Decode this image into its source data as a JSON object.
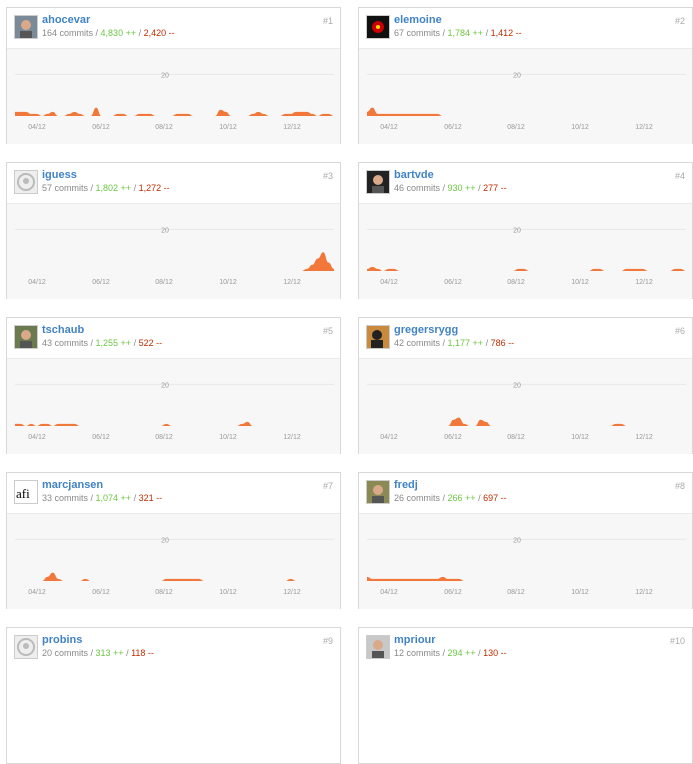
{
  "contributors": [
    {
      "rank": "#1",
      "login": "ahocevar",
      "commits": "164 commits",
      "additions": "4,830 ++",
      "deletions": "2,420 --",
      "avatar": "avatar-photo",
      "weekly": [
        2,
        2,
        2,
        1,
        1,
        0,
        1,
        2,
        0,
        0,
        1,
        2,
        1,
        0,
        0,
        4,
        0,
        0,
        0,
        1,
        1,
        0,
        0,
        1,
        1,
        1,
        0,
        0,
        0,
        0,
        1,
        1,
        1,
        0,
        0,
        0,
        0,
        0,
        3,
        2,
        0,
        0,
        0,
        0,
        1,
        2,
        1,
        0,
        0,
        0,
        1,
        1,
        2,
        2,
        2,
        1,
        0,
        1,
        1,
        0
      ]
    },
    {
      "rank": "#2",
      "login": "elemoine",
      "commits": "67 commits",
      "additions": "1,784 ++",
      "deletions": "1,412 --",
      "avatar": "avatar-hal",
      "weekly": [
        2,
        4,
        1,
        1,
        1,
        1,
        1,
        1,
        1,
        1,
        1,
        1,
        1,
        1,
        0,
        0,
        0,
        0,
        0,
        0,
        0,
        0,
        0,
        0,
        0,
        0,
        0,
        0,
        0,
        0,
        0,
        0,
        0,
        0,
        0,
        0,
        0,
        0,
        0,
        0,
        0,
        0,
        0,
        0,
        0,
        0,
        0,
        0,
        0,
        0,
        0,
        0,
        0,
        0,
        0,
        0,
        0,
        0,
        0,
        0
      ]
    },
    {
      "rank": "#3",
      "login": "iguess",
      "commits": "57 commits",
      "additions": "1,802 ++",
      "deletions": "1,272 --",
      "avatar": "avatar-default",
      "weekly": [
        0,
        0,
        0,
        0,
        0,
        0,
        0,
        0,
        0,
        0,
        0,
        0,
        0,
        0,
        0,
        0,
        0,
        0,
        0,
        0,
        0,
        0,
        0,
        0,
        0,
        0,
        0,
        0,
        0,
        0,
        0,
        0,
        0,
        0,
        0,
        0,
        0,
        0,
        0,
        0,
        0,
        0,
        0,
        0,
        0,
        0,
        0,
        0,
        0,
        0,
        0,
        0,
        0,
        0,
        1,
        3,
        6,
        9,
        4,
        1
      ]
    },
    {
      "rank": "#4",
      "login": "bartvde",
      "commits": "46 commits",
      "additions": "930 ++",
      "deletions": "277 --",
      "avatar": "avatar-photo2",
      "weekly": [
        1,
        2,
        1,
        0,
        1,
        1,
        0,
        0,
        0,
        0,
        0,
        0,
        0,
        0,
        0,
        0,
        0,
        0,
        0,
        0,
        0,
        0,
        0,
        0,
        0,
        0,
        0,
        0,
        1,
        1,
        0,
        0,
        0,
        0,
        0,
        0,
        0,
        0,
        0,
        0,
        0,
        0,
        1,
        1,
        0,
        0,
        0,
        0,
        1,
        1,
        1,
        1,
        0,
        0,
        0,
        0,
        0,
        1,
        1,
        0
      ]
    },
    {
      "rank": "#5",
      "login": "tschaub",
      "commits": "43 commits",
      "additions": "1,255 ++",
      "deletions": "522 --",
      "avatar": "avatar-photo3",
      "weekly": [
        1,
        1,
        0,
        1,
        0,
        1,
        1,
        0,
        1,
        1,
        1,
        1,
        0,
        0,
        0,
        0,
        0,
        0,
        0,
        0,
        0,
        0,
        0,
        0,
        0,
        0,
        0,
        0,
        1,
        0,
        0,
        0,
        0,
        0,
        0,
        0,
        0,
        0,
        0,
        0,
        0,
        0,
        1,
        2,
        0,
        0,
        0,
        0,
        0,
        0,
        0,
        0,
        0,
        0,
        0,
        0,
        0,
        0,
        0,
        0
      ]
    },
    {
      "rank": "#6",
      "login": "gregersrygg",
      "commits": "42 commits",
      "additions": "1,177 ++",
      "deletions": "786 --",
      "avatar": "avatar-silhouette",
      "weekly": [
        0,
        0,
        0,
        0,
        0,
        0,
        0,
        0,
        0,
        0,
        0,
        0,
        0,
        0,
        0,
        0,
        3,
        4,
        1,
        0,
        0,
        3,
        2,
        0,
        0,
        0,
        0,
        0,
        0,
        0,
        0,
        0,
        0,
        0,
        0,
        0,
        0,
        0,
        0,
        0,
        0,
        0,
        0,
        0,
        0,
        0,
        1,
        1,
        0,
        0,
        0,
        0,
        0,
        0,
        0,
        0,
        0,
        0,
        0,
        0
      ]
    },
    {
      "rank": "#7",
      "login": "marcjansen",
      "commits": "33 commits",
      "additions": "1,074 ++",
      "deletions": "321 --",
      "avatar": "avatar-afi",
      "weekly": [
        0,
        0,
        0,
        0,
        0,
        0,
        2,
        4,
        1,
        0,
        0,
        0,
        0,
        1,
        0,
        0,
        0,
        0,
        0,
        0,
        0,
        0,
        0,
        0,
        0,
        0,
        0,
        0,
        1,
        1,
        1,
        1,
        1,
        1,
        1,
        0,
        0,
        0,
        0,
        0,
        0,
        0,
        0,
        0,
        0,
        0,
        0,
        0,
        0,
        0,
        0,
        1,
        0,
        0,
        0,
        0,
        0,
        0,
        0,
        0
      ]
    },
    {
      "rank": "#8",
      "login": "fredj",
      "commits": "26 commits",
      "additions": "266 ++",
      "deletions": "697 --",
      "avatar": "avatar-photo4",
      "weekly": [
        2,
        1,
        1,
        1,
        1,
        1,
        1,
        1,
        1,
        1,
        1,
        1,
        1,
        1,
        2,
        1,
        1,
        1,
        0,
        0,
        0,
        0,
        0,
        0,
        0,
        0,
        0,
        0,
        0,
        0,
        0,
        0,
        0,
        0,
        0,
        0,
        0,
        0,
        0,
        0,
        0,
        0,
        0,
        0,
        0,
        0,
        0,
        0,
        0,
        0,
        0,
        0,
        0,
        0,
        0,
        0,
        0,
        0,
        0,
        0
      ]
    },
    {
      "rank": "#9",
      "login": "probins",
      "commits": "20 commits",
      "additions": "313 ++",
      "deletions": "118 --",
      "avatar": "avatar-default",
      "weekly": []
    },
    {
      "rank": "#10",
      "login": "mpriour",
      "commits": "12 commits",
      "additions": "294 ++",
      "deletions": "130 --",
      "avatar": "avatar-photo5",
      "weekly": []
    }
  ],
  "graph": {
    "y_label": "20",
    "y_value": 20,
    "x_ticks": [
      "04/12",
      "06/12",
      "08/12",
      "10/12",
      "12/12"
    ],
    "area_color": "#f1783a",
    "gridline_color": "#e8e8e8"
  }
}
